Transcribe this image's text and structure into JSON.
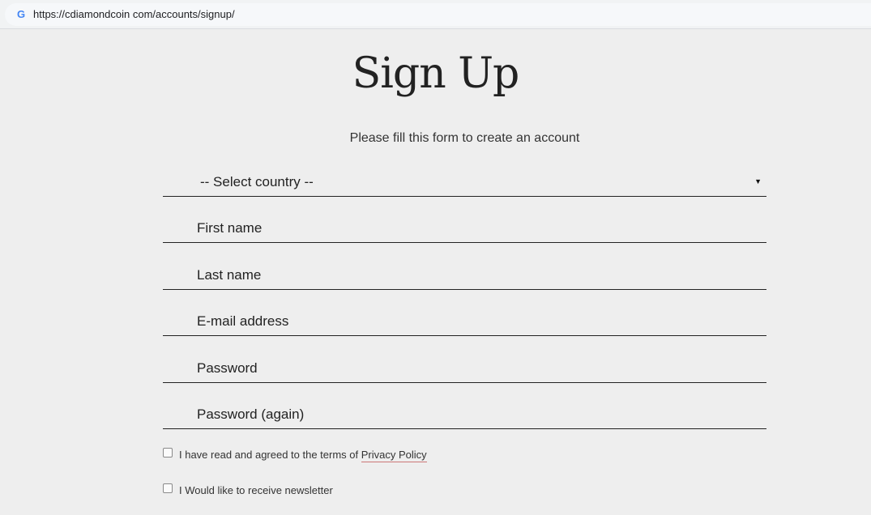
{
  "browser": {
    "url": "https://cdiamondcoin com/accounts/signup/",
    "favicon": "google-g-icon"
  },
  "page": {
    "title": "Sign Up",
    "subtitle": "Please fill this form to create an account"
  },
  "form": {
    "country": {
      "selected": "-- Select country --"
    },
    "first_name": {
      "placeholder": "First name"
    },
    "last_name": {
      "placeholder": "Last name"
    },
    "email": {
      "placeholder": "E-mail address"
    },
    "password": {
      "placeholder": "Password"
    },
    "password_again": {
      "placeholder": "Password (again)"
    },
    "terms": {
      "label": "I have read and agreed to the terms of ",
      "link": "Privacy Policy",
      "checked": false
    },
    "newsletter": {
      "label": "I Would like to receive newsletter",
      "checked": false
    }
  }
}
